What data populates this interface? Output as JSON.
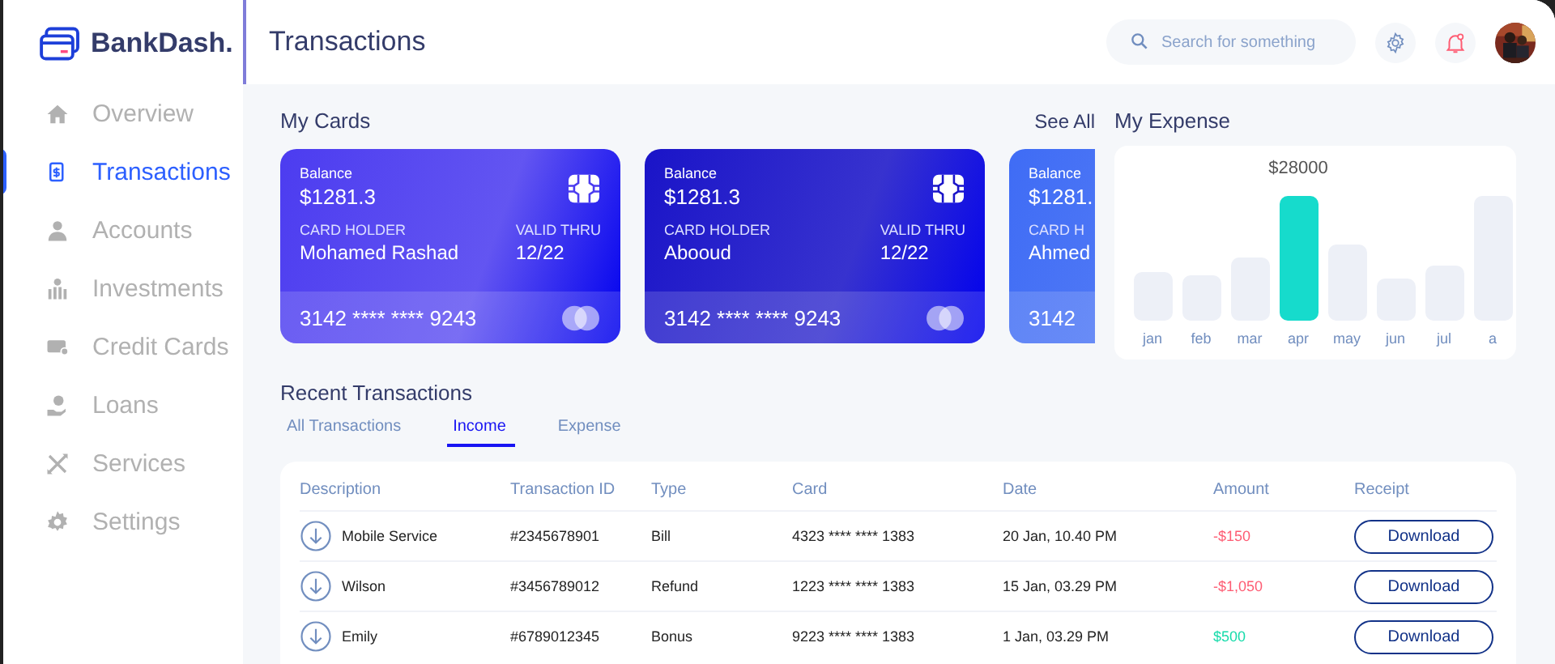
{
  "app": {
    "logo": "BankDash."
  },
  "sidebar": {
    "items": [
      {
        "label": "Overview",
        "selected": false
      },
      {
        "label": "Transactions",
        "selected": true
      },
      {
        "label": "Accounts",
        "selected": false
      },
      {
        "label": "Investments",
        "selected": false
      },
      {
        "label": "Credit Cards",
        "selected": false
      },
      {
        "label": "Loans",
        "selected": false
      },
      {
        "label": "Services",
        "selected": false
      },
      {
        "label": "Settings",
        "selected": false
      }
    ]
  },
  "header": {
    "title": "Transactions",
    "search": {
      "placeholder": "Search for something"
    }
  },
  "my_cards": {
    "title": "My Cards",
    "link": "See All",
    "cards": [
      {
        "color": "#4c3cf0",
        "balance_label": "Balance",
        "balance": "$1281.3",
        "holder_label": "CARD HOLDER",
        "holder": "Mohamed Rashad",
        "valid_label": "VALID THRU",
        "valid": "12/22",
        "number": "3142 **** **** 9243"
      },
      {
        "color": "#1a14c8",
        "balance_label": "Balance",
        "balance": "$1281.3",
        "holder_label": "CARD HOLDER",
        "holder": "Abooud",
        "valid_label": "VALID THRU",
        "valid": "12/22",
        "number": "3142 **** **** 9243"
      },
      {
        "color": "#3f6cf5",
        "balance_label": "Balance",
        "balance": "$1281.",
        "holder_label": "CARD H",
        "holder": "Ahmed",
        "number": "3142"
      }
    ]
  },
  "my_expense": {
    "title": "My Expense",
    "value_label": "$28000",
    "months": [
      {
        "label": "jan",
        "selected": false
      },
      {
        "label": "feb",
        "selected": false
      },
      {
        "label": "mar",
        "selected": false
      },
      {
        "label": "apr",
        "selected": true
      },
      {
        "label": "may",
        "selected": false
      },
      {
        "label": "jun",
        "selected": false
      },
      {
        "label": "jul",
        "selected": false
      },
      {
        "label": "a",
        "selected": false
      }
    ]
  },
  "recent_transactions": {
    "title": "Recent Transactions",
    "tabs": [
      {
        "label": "All Transactions",
        "selected": false
      },
      {
        "label": "Income",
        "selected": true
      },
      {
        "label": "Expense",
        "selected": false
      }
    ],
    "columns": [
      "Description",
      "Transaction ID",
      "Type",
      "Card",
      "Date",
      "Amount",
      "Receipt"
    ],
    "rows": [
      {
        "description": "Mobile Service",
        "id": "#2345678901",
        "type": "Bill",
        "card": "4323 **** **** 1383",
        "date": "20 Jan, 10.40 PM",
        "amount": "-$150",
        "kind": "debit",
        "receipt": "Download"
      },
      {
        "description": "Wilson",
        "id": "#3456789012",
        "type": "Refund",
        "card": "1223 **** **** 1383",
        "date": "15 Jan, 03.29 PM",
        "amount": "-$1,050",
        "kind": "debit",
        "receipt": "Download"
      },
      {
        "description": "Emily",
        "id": "#6789012345",
        "type": "Bonus",
        "card": "9223 **** **** 1383",
        "date": "1 Jan, 03.29 PM",
        "amount": "$500",
        "kind": "credit",
        "receipt": "Download"
      }
    ]
  }
}
